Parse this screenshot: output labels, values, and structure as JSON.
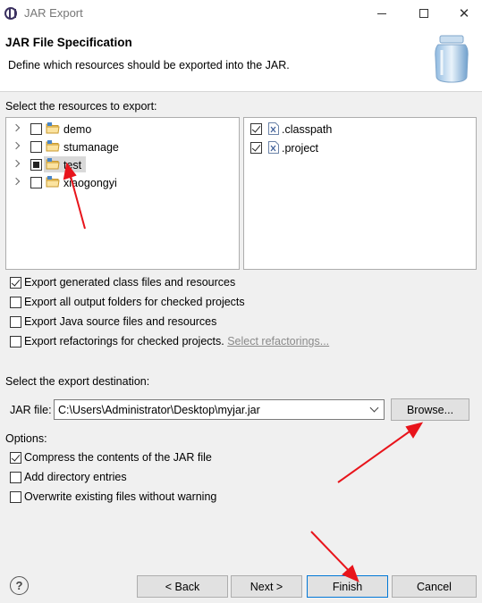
{
  "window": {
    "title": "JAR Export",
    "minimize_icon": "minimize-icon",
    "maximize_icon": "maximize-icon",
    "close_icon": "close-icon"
  },
  "header": {
    "title": "JAR File Specification",
    "description": "Define which resources should be exported into the JAR.",
    "icon": "jar-icon"
  },
  "resources": {
    "label": "Select the resources to export:",
    "projects": [
      {
        "name": "demo",
        "state": "unchecked"
      },
      {
        "name": "stumanage",
        "state": "unchecked"
      },
      {
        "name": "test",
        "state": "partial",
        "selected": true
      },
      {
        "name": "xiaogongyi",
        "state": "unchecked"
      }
    ],
    "files": [
      {
        "name": ".classpath",
        "checked": true
      },
      {
        "name": ".project",
        "checked": true
      }
    ]
  },
  "export_options": [
    {
      "label": "Export generated class files and resources",
      "checked": true
    },
    {
      "label": "Export all output folders for checked projects",
      "checked": false
    },
    {
      "label": "Export Java source files and resources",
      "checked": false
    },
    {
      "label": "Export refactorings for checked projects.",
      "checked": false,
      "link": "Select refactorings..."
    }
  ],
  "destination": {
    "label": "Select the export destination:",
    "jar_file_label": "JAR file:",
    "jar_file_value": "C:\\Users\\Administrator\\Desktop\\myjar.jar",
    "browse_label": "Browse..."
  },
  "options": {
    "label": "Options:",
    "items": [
      {
        "label": "Compress the contents of the JAR file",
        "checked": true
      },
      {
        "label": "Add directory entries",
        "checked": false
      },
      {
        "label": "Overwrite existing files without warning",
        "checked": false
      }
    ]
  },
  "footer": {
    "help_icon": "help-icon",
    "back_label": "< Back",
    "next_label": "Next >",
    "finish_label": "Finish",
    "cancel_label": "Cancel"
  },
  "annotations": {
    "arrow_color": "#e8141b"
  }
}
